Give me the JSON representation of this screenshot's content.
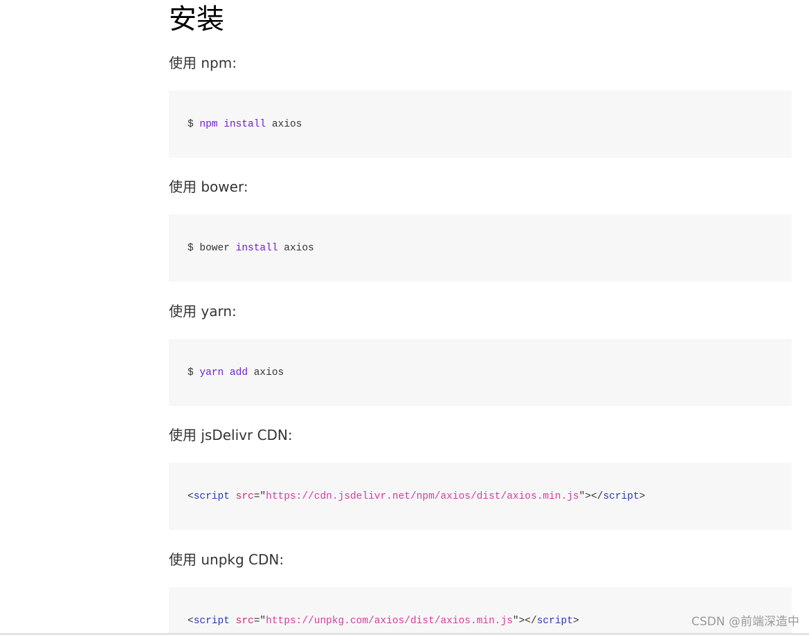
{
  "page": {
    "title": "安装"
  },
  "sections": [
    {
      "label": "使用 npm:",
      "code": [
        {
          "t": "$ ",
          "c": "plain"
        },
        {
          "t": "npm",
          "c": "cmd"
        },
        {
          "t": " ",
          "c": "plain"
        },
        {
          "t": "install",
          "c": "cmd"
        },
        {
          "t": " axios",
          "c": "plain"
        }
      ]
    },
    {
      "label": "使用 bower:",
      "code": [
        {
          "t": "$ bower ",
          "c": "plain"
        },
        {
          "t": "install",
          "c": "cmd"
        },
        {
          "t": " axios",
          "c": "plain"
        }
      ]
    },
    {
      "label": "使用 yarn:",
      "code": [
        {
          "t": "$ ",
          "c": "plain"
        },
        {
          "t": "yarn",
          "c": "cmd"
        },
        {
          "t": " ",
          "c": "plain"
        },
        {
          "t": "add",
          "c": "cmd"
        },
        {
          "t": " axios",
          "c": "plain"
        }
      ]
    },
    {
      "label": "使用 jsDelivr CDN:",
      "code": [
        {
          "t": "<",
          "c": "plain"
        },
        {
          "t": "script",
          "c": "tag"
        },
        {
          "t": " ",
          "c": "plain"
        },
        {
          "t": "src",
          "c": "attr"
        },
        {
          "t": "=\"",
          "c": "plain"
        },
        {
          "t": "https://cdn.jsdelivr.net/npm/axios/dist/axios.min.js",
          "c": "str"
        },
        {
          "t": "\"></",
          "c": "plain"
        },
        {
          "t": "script",
          "c": "tag"
        },
        {
          "t": ">",
          "c": "plain"
        }
      ]
    },
    {
      "label": "使用 unpkg CDN:",
      "code": [
        {
          "t": "<",
          "c": "plain"
        },
        {
          "t": "script",
          "c": "tag"
        },
        {
          "t": " ",
          "c": "plain"
        },
        {
          "t": "src",
          "c": "attr"
        },
        {
          "t": "=\"",
          "c": "plain"
        },
        {
          "t": "https://unpkg.com/axios/dist/axios.min.js",
          "c": "str"
        },
        {
          "t": "\"></",
          "c": "plain"
        },
        {
          "t": "script",
          "c": "tag"
        },
        {
          "t": ">",
          "c": "plain"
        }
      ]
    }
  ],
  "watermark": "CSDN @前端深造中",
  "colors": {
    "code_background": "#f7f7f7",
    "command": "#6a1fd1",
    "tag": "#2a3bb0",
    "attribute": "#c02f7d",
    "string": "#d23ea1",
    "text": "#333333"
  }
}
